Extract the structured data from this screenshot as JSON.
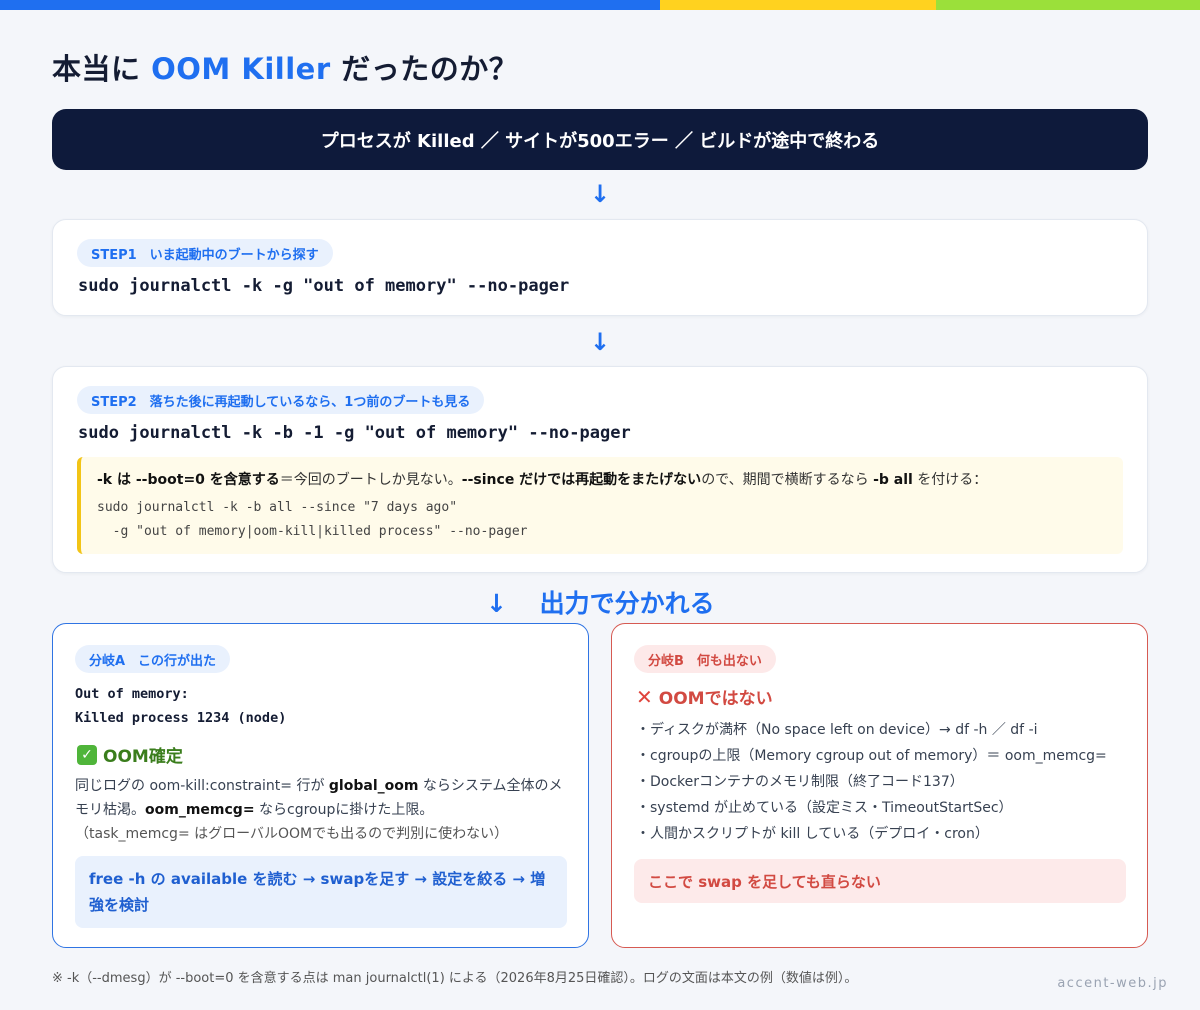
{
  "colors": {
    "accent": "#1f6ff0",
    "dark": "#0e1a3b",
    "green": "#3a7d1c",
    "red": "#d24a42",
    "yellow": "#f2c416"
  },
  "title": {
    "prefix": "本当に ",
    "accent": "OOM Killer",
    "suffix": " だったのか？"
  },
  "banner": "プロセスが Killed ／ サイトが500エラー ／ ビルドが途中で終わる",
  "step1": {
    "label": "STEP1　いま起動中のブートから探す",
    "command": "sudo journalctl -k -g \"out of memory\" --no-pager"
  },
  "step2": {
    "label": "STEP2　落ちた後に再起動しているなら、1つ前のブートも見る",
    "command": "sudo journalctl -k -b -1 -g \"out of memory\" --no-pager",
    "note": {
      "b1": "-k は --boot=0 を含意する",
      "t1": "＝今回のブートしか見ない。",
      "b2": "--since だけでは再起動をまたげない",
      "t2": "ので、期間で横断するなら ",
      "b3": "-b all",
      "t3": " を付ける：",
      "code_line1": "sudo journalctl -k -b all --since \"7 days ago\"",
      "code_line2": "  -g \"out of memory|oom-kill|killed process\" --no-pager"
    }
  },
  "split": {
    "arrow": "↓",
    "label": "出力で分かれる"
  },
  "branch_a": {
    "label": "分岐A　この行が出た",
    "out_line1": "Out of memory:",
    "out_line2": "Killed process 1234 (node)",
    "heading": "OOM確定",
    "icon": "check-icon",
    "p1": "同じログの oom-kill:constraint= 行が ",
    "p1b": "global_oom",
    "p2": " ならシステム全体のメモリ枯渇。",
    "p2b": "oom_memcg=",
    "p3": " ならcgroupに掛けた上限。",
    "p4": "（task_memcg= はグローバルOOMでも出るので判別に使わない）",
    "action": "free -h の available を読む → swapを足す → 設定を絞る → 増強を検討"
  },
  "branch_b": {
    "label": "分岐B　何も出ない",
    "heading": "OOMではない",
    "icon": "x-icon",
    "items": [
      "・ディスクが満杯（No space left on device）→ df -h ／ df -i",
      "・cgroupの上限（Memory cgroup out of memory）＝ oom_memcg=",
      "・Dockerコンテナのメモリ制限（終了コード137）",
      "・systemd が止めている（設定ミス・TimeoutStartSec）",
      "・人間かスクリプトが kill している（デプロイ・cron）"
    ],
    "warning": "ここで swap を足しても直らない"
  },
  "footnote": "※ -k（--dmesg）が --boot=0 を含意する点は man journalctl(1) による（2026年8月25日確認）。ログの文面は本文の例（数値は例）。",
  "brand": "accent-web.jp"
}
